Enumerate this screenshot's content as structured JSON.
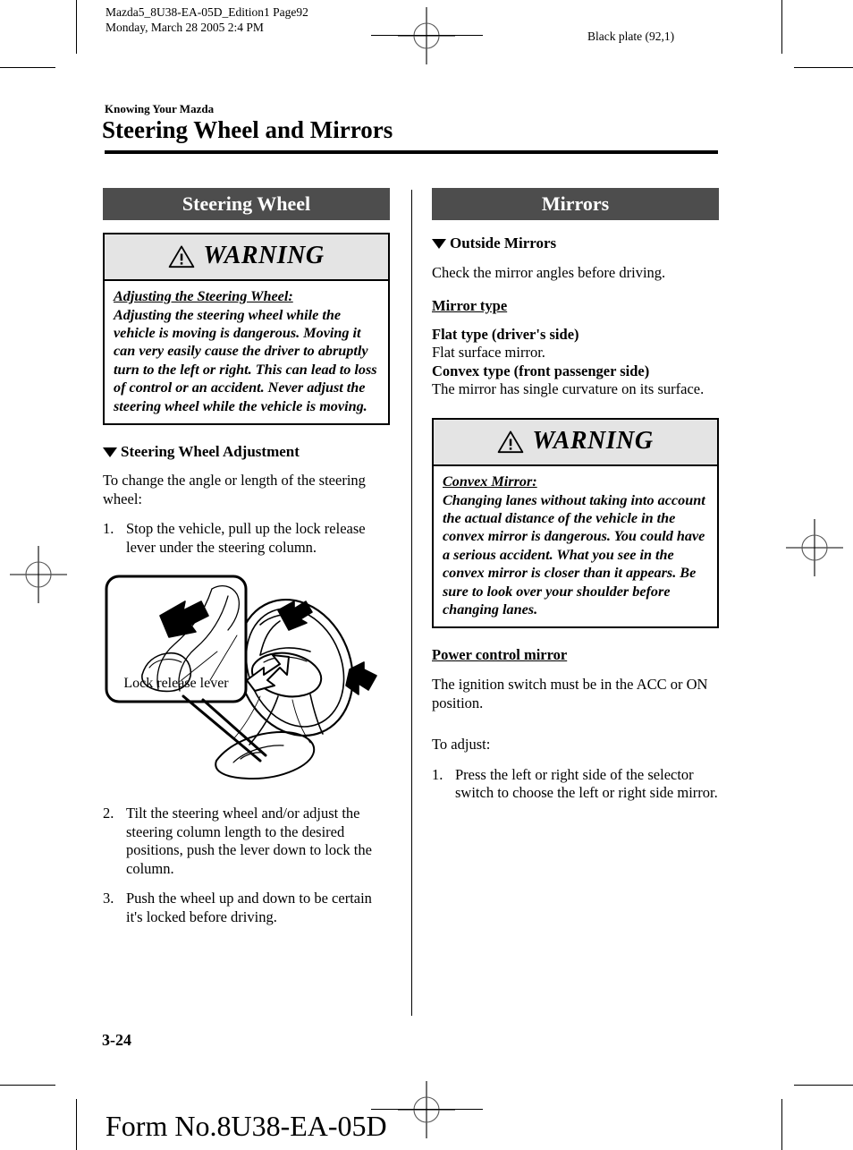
{
  "print_marks": {
    "header_line1": "Mazda5_8U38-EA-05D_Edition1 Page92",
    "header_line2": "Monday, March 28 2005 2:4 PM",
    "black_plate": "Black plate (92,1)"
  },
  "document": {
    "breadcrumb": "Knowing Your Mazda",
    "title": "Steering Wheel and Mirrors",
    "page_number": "3-24",
    "form_number": "Form No.8U38-EA-05D"
  },
  "left_column": {
    "section_title": "Steering Wheel",
    "warning": {
      "label": "WARNING",
      "title": "Adjusting the Steering Wheel:",
      "body": "Adjusting the steering wheel while the vehicle is moving is dangerous. Moving it can very easily cause the driver to abruptly turn to the left or right. This can lead to loss of control or an accident. Never adjust the steering wheel while the vehicle is moving."
    },
    "subsection_title": "Steering Wheel Adjustment",
    "intro": "To change the angle or length of the steering wheel:",
    "steps_before_figure": [
      {
        "num": "1.",
        "text": "Stop the vehicle, pull up the lock release lever under the steering column."
      }
    ],
    "figure": {
      "caption": "Lock release lever"
    },
    "steps_after_figure": [
      {
        "num": "2.",
        "text": "Tilt the steering wheel and/or adjust the steering column length to the desired positions, push the lever down to lock the column."
      },
      {
        "num": "3.",
        "text": "Push the wheel up and down to be certain it's locked before driving."
      }
    ]
  },
  "right_column": {
    "section_title": "Mirrors",
    "subsection_title": "Outside Mirrors",
    "intro": "Check the mirror angles before driving.",
    "mirror_type_heading": "Mirror type",
    "flat_type_label": "Flat type (driver's side)",
    "flat_type_desc": "Flat surface mirror.",
    "convex_type_label": "Convex type (front passenger side)",
    "convex_type_desc": "The mirror has single curvature on its surface.",
    "warning": {
      "label": "WARNING",
      "title": "Convex Mirror:",
      "body": "Changing lanes without taking into account the actual distance of the vehicle in the convex mirror is dangerous. You could have a serious accident. What you see in the convex mirror is closer than it appears. Be sure to look over your shoulder before changing lanes."
    },
    "power_mirror_heading": "Power control mirror",
    "power_mirror_text": "The ignition switch must be in the ACC or ON position.",
    "adjust_intro": "To adjust:",
    "adjust_steps": [
      {
        "num": "1.",
        "text": "Press the left or right side of the selector switch to choose the left or right side mirror."
      }
    ]
  },
  "colors": {
    "banner_background": "#4d4d4d",
    "banner_text": "#ffffff",
    "warning_header_background": "#e4e4e4",
    "rule": "#000000"
  }
}
